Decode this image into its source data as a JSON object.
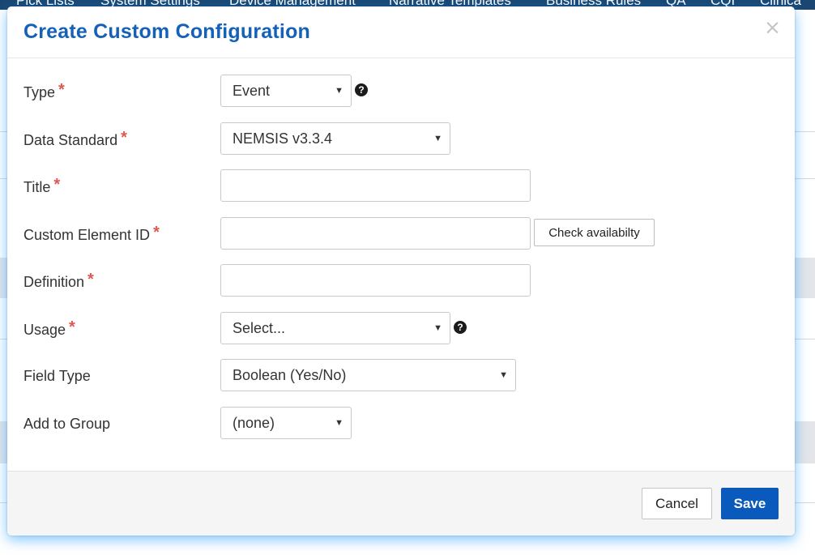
{
  "background": {
    "nav_items": [
      "Pick Lists",
      "System Settings",
      "Device Management",
      "Narrative Templates",
      "Business Rules",
      "QA",
      "CQI",
      "Clinica"
    ]
  },
  "modal": {
    "title": "Create Custom Configuration",
    "close_glyph": "×",
    "required_mark": "*",
    "help_glyph": "?",
    "caret_glyph": "▼",
    "fields": {
      "type": {
        "label": "Type",
        "value": "Event"
      },
      "data_standard": {
        "label": "Data Standard",
        "value": "NEMSIS v3.3.4"
      },
      "title": {
        "label": "Title",
        "value": ""
      },
      "custom_element_id": {
        "label": "Custom Element ID",
        "value": "",
        "check_button": "Check availabilty"
      },
      "definition": {
        "label": "Definition",
        "value": ""
      },
      "usage": {
        "label": "Usage",
        "value": "Select..."
      },
      "field_type": {
        "label": "Field Type",
        "value": "Boolean (Yes/No)"
      },
      "add_to_group": {
        "label": "Add to Group",
        "value": "(none)"
      }
    },
    "footer": {
      "cancel_label": "Cancel",
      "save_label": "Save"
    }
  },
  "colors": {
    "title": "#1561b8",
    "required": "#e0574f",
    "save_button": "#0a59bd",
    "nav_background": "#16436f",
    "modal_glow": "#1496ff"
  },
  "icons": {
    "close": "close-icon",
    "help": "question-circle-icon",
    "caret": "chevron-down-icon"
  }
}
